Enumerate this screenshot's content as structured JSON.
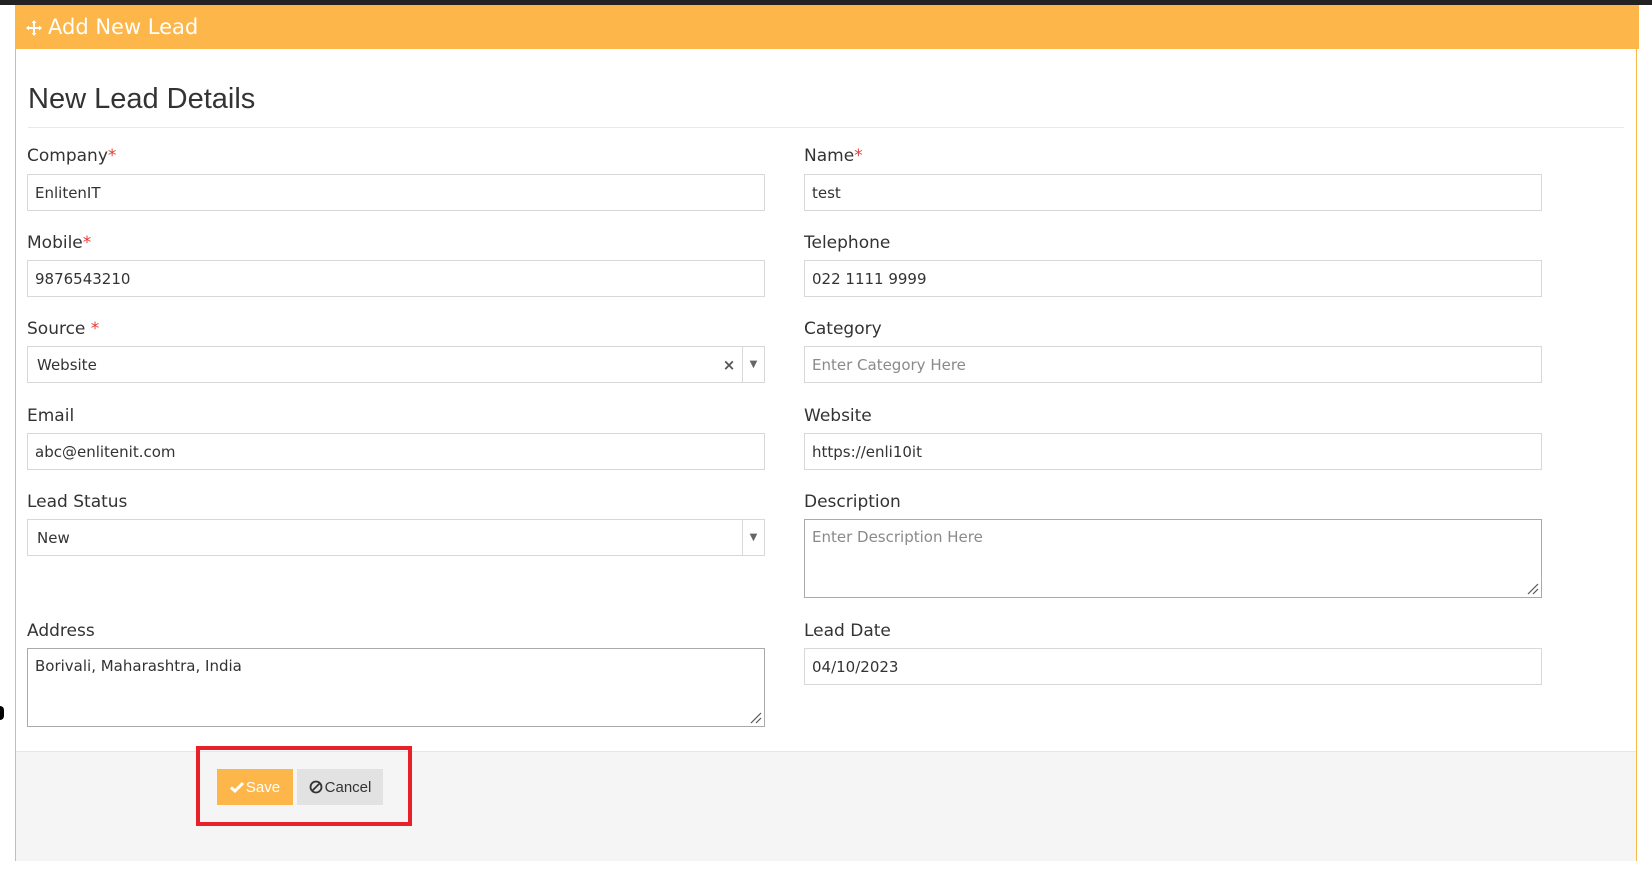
{
  "header": {
    "title": "Add New Lead",
    "icon": "plus-move-icon",
    "color": "#fdb64a"
  },
  "section_title": "New Lead Details",
  "fields": {
    "company": {
      "label": "Company",
      "required": "*",
      "value": "EnlitenIT"
    },
    "name": {
      "label": "Name",
      "required": "*",
      "value": "test"
    },
    "mobile": {
      "label": "Mobile",
      "required": "*",
      "value": "9876543210"
    },
    "telephone": {
      "label": "Telephone",
      "value": "022 1111 9999"
    },
    "source": {
      "label": "Source ",
      "required": "*",
      "value": "Website",
      "clear": "×",
      "arrow": "▼"
    },
    "category": {
      "label": "Category",
      "placeholder": "Enter Category Here"
    },
    "email": {
      "label": "Email",
      "value": "abc@enlitenit.com"
    },
    "website": {
      "label": "Website",
      "value": "https://enli10it"
    },
    "lead_status": {
      "label": "Lead Status",
      "value": "New",
      "arrow": "▼"
    },
    "description": {
      "label": "Description",
      "placeholder": "Enter Description Here"
    },
    "address": {
      "label": "Address",
      "value": "Borivali, Maharashtra, India"
    },
    "lead_date": {
      "label": "Lead Date",
      "value": "04/10/2023"
    }
  },
  "actions": {
    "save_label": "Save",
    "cancel_label": "Cancel",
    "highlight_color": "#e8202a"
  }
}
